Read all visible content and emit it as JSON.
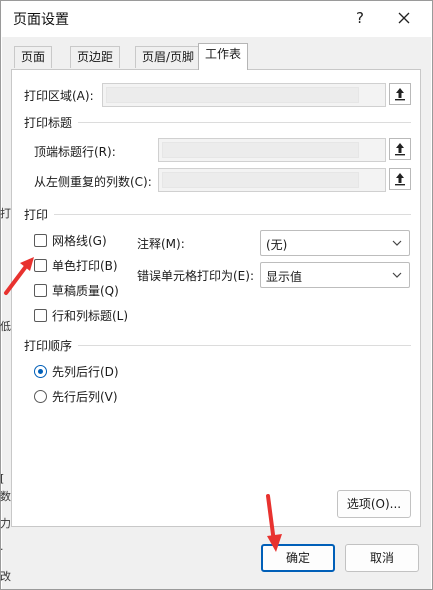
{
  "background": {
    "fragments": [
      "打",
      "低",
      "[",
      "数",
      "力",
      ".",
      "改"
    ]
  },
  "dialog": {
    "title": "页面设置",
    "help_label": "?",
    "close_label": "✕"
  },
  "tabs": [
    {
      "label": "页面"
    },
    {
      "label": "页边距"
    },
    {
      "label": "页眉/页脚"
    },
    {
      "label": "工作表"
    }
  ],
  "print_area": {
    "label": "打印区域(A):",
    "value": ""
  },
  "print_titles": {
    "heading": "打印标题",
    "rows_label": "顶端标题行(R):",
    "rows_value": "",
    "cols_label": "从左侧重复的列数(C):",
    "cols_value": ""
  },
  "print": {
    "heading": "打印",
    "gridlines": {
      "label": "网格线(G)",
      "checked": false
    },
    "mono": {
      "label": "单色打印(B)",
      "checked": false
    },
    "draft": {
      "label": "草稿质量(Q)",
      "checked": false
    },
    "headings": {
      "label": "行和列标题(L)",
      "checked": false
    },
    "comments": {
      "label": "注释(M):",
      "value": "(无)"
    },
    "errors": {
      "label": "错误单元格打印为(E):",
      "value": "显示值"
    }
  },
  "order": {
    "heading": "打印顺序",
    "down_then_over": {
      "label": "先列后行(D)",
      "checked": true
    },
    "over_then_down": {
      "label": "先行后列(V)",
      "checked": false
    }
  },
  "buttons": {
    "options": "选项(O)...",
    "ok": "确定",
    "cancel": "取消"
  },
  "colors": {
    "accent": "#005fb8",
    "arrow": "#e8322f"
  }
}
